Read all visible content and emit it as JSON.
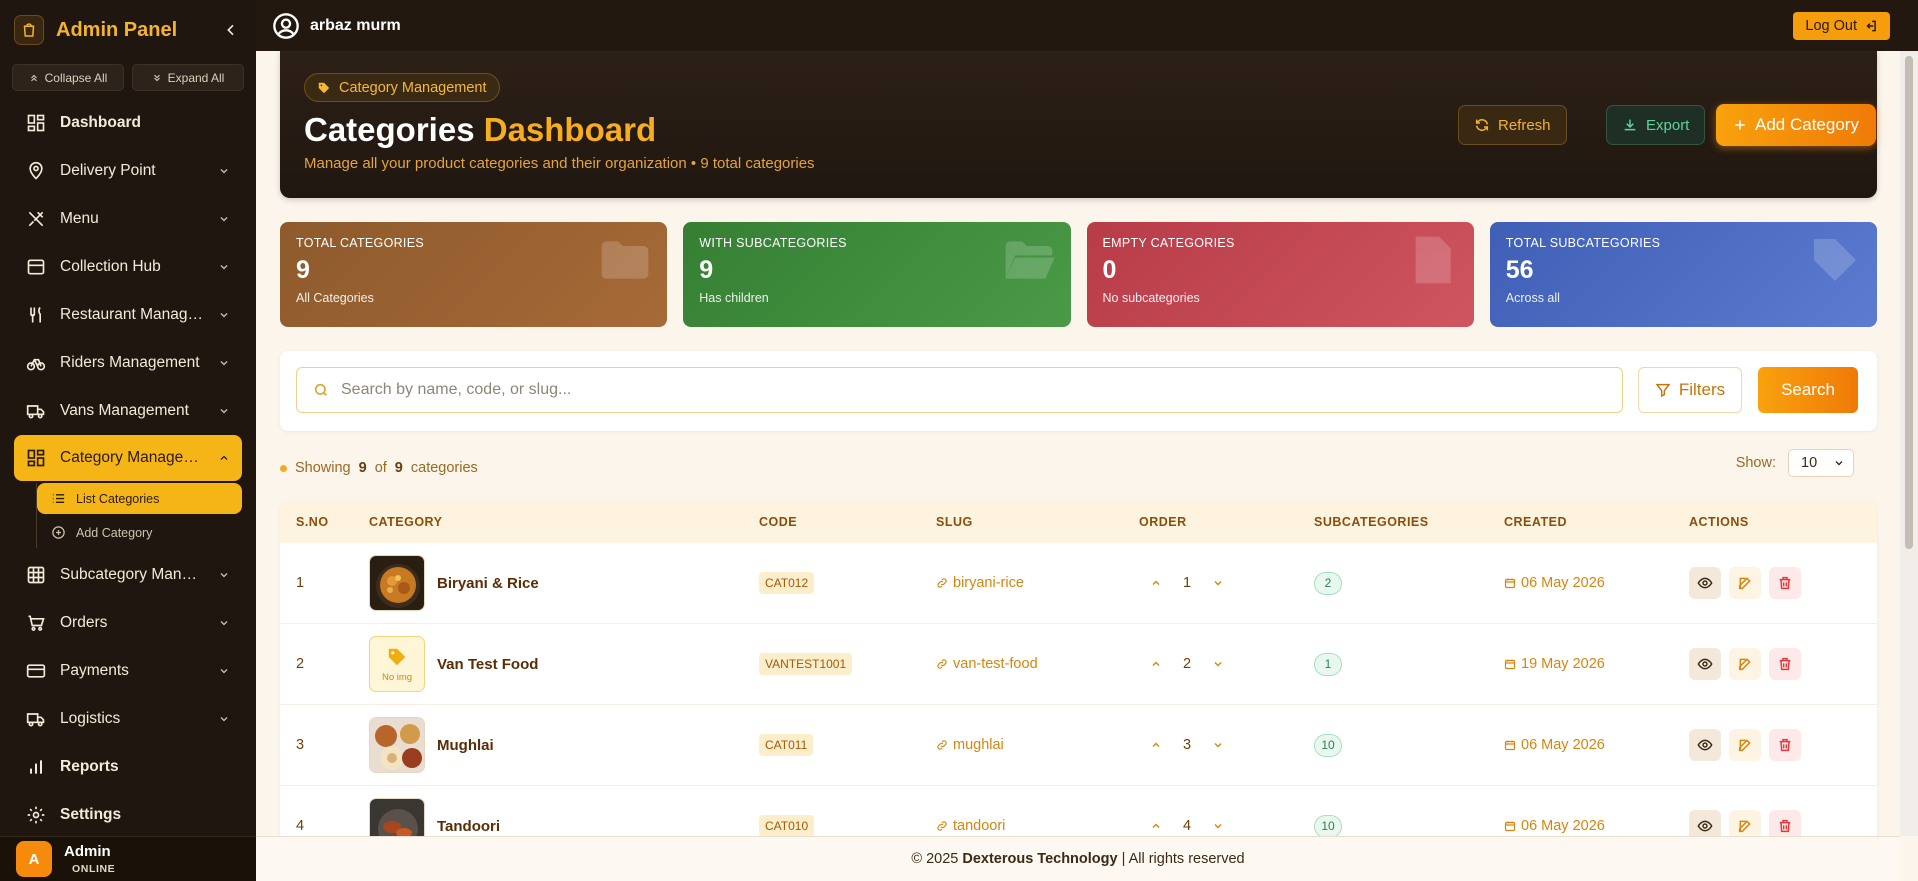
{
  "sidebar": {
    "title": "Admin Panel",
    "collapse_all": "Collapse All",
    "expand_all": "Expand All",
    "items": [
      {
        "label": "Dashboard",
        "icon": "grid-icon"
      },
      {
        "label": "Delivery Point",
        "icon": "map-pin-icon"
      },
      {
        "label": "Menu",
        "icon": "utensils-crossed-icon"
      },
      {
        "label": "Collection Hub",
        "icon": "box-icon"
      },
      {
        "label": "Restaurant Managem…",
        "icon": "fork-knife-icon"
      },
      {
        "label": "Riders Management",
        "icon": "bike-icon"
      },
      {
        "label": "Vans Management",
        "icon": "truck-icon"
      },
      {
        "label": "Category Management",
        "icon": "grid-icon"
      },
      {
        "label": "Subcategory Manage…",
        "icon": "table-icon"
      },
      {
        "label": "Orders",
        "icon": "cart-icon"
      },
      {
        "label": "Payments",
        "icon": "credit-card-icon"
      },
      {
        "label": "Logistics",
        "icon": "truck-icon"
      },
      {
        "label": "Reports",
        "icon": "bar-chart-icon"
      },
      {
        "label": "Settings",
        "icon": "gear-icon"
      }
    ],
    "sub_items": [
      {
        "label": "List Categories",
        "icon": "list-icon"
      },
      {
        "label": "Add Category",
        "icon": "plus-circle-icon"
      }
    ],
    "user": {
      "initial": "A",
      "name": "Admin",
      "status": "ONLINE"
    }
  },
  "topbar": {
    "user_name": "arbaz murm",
    "logout_label": "Log Out"
  },
  "hero": {
    "chip": "Category Management",
    "title_main": "Categories",
    "title_accent": "Dashboard",
    "subtitle": "Manage all your product categories and their organization • 9 total categories",
    "refresh_label": "Refresh",
    "export_label": "Export",
    "add_label": "Add Category"
  },
  "stats": [
    {
      "label": "TOTAL CATEGORIES",
      "value": "9",
      "sub": "All Categories",
      "color": "#8e5a2c"
    },
    {
      "label": "WITH SUBCATEGORIES",
      "value": "9",
      "sub": "Has children",
      "color": "#3e8a3c"
    },
    {
      "label": "EMPTY CATEGORIES",
      "value": "0",
      "sub": "No subcategories",
      "color": "#c04450"
    },
    {
      "label": "TOTAL SUBCATEGORIES",
      "value": "56",
      "sub": "Across all",
      "color": "#4c6bc0"
    }
  ],
  "search": {
    "placeholder": "Search by name, code, or slug...",
    "value": "",
    "filters_label": "Filters",
    "search_label": "Search"
  },
  "listing": {
    "showing_prefix": "Showing",
    "shown": "9",
    "of_text": "of",
    "total": "9",
    "suffix": "categories",
    "show_label": "Show:",
    "page_size": "10"
  },
  "table": {
    "headers": [
      "S.NO",
      "CATEGORY",
      "CODE",
      "SLUG",
      "ORDER",
      "SUBCATEGORIES",
      "CREATED",
      "ACTIONS"
    ],
    "rows": [
      {
        "sno": "1",
        "name": "Biryani & Rice",
        "image": "biryani",
        "code": "CAT012",
        "slug": "biryani-rice",
        "order": "1",
        "subcategories": "2",
        "created": "06 May 2026"
      },
      {
        "sno": "2",
        "name": "Van Test Food",
        "image": "none",
        "no_img_label": "No img",
        "code": "VANTEST1001",
        "slug": "van-test-food",
        "order": "2",
        "subcategories": "1",
        "created": "19 May 2026"
      },
      {
        "sno": "3",
        "name": "Mughlai",
        "image": "mughlai",
        "code": "CAT011",
        "slug": "mughlai",
        "order": "3",
        "subcategories": "10",
        "created": "06 May 2026"
      },
      {
        "sno": "4",
        "name": "Tandoori",
        "image": "tandoori",
        "code": "CAT010",
        "slug": "tandoori",
        "order": "4",
        "subcategories": "10",
        "created": "06 May 2026"
      }
    ]
  },
  "footer": {
    "prefix": "© 2025",
    "company": "Dexterous Technology",
    "suffix": "| All rights reserved"
  },
  "colors": {
    "accent": "#f6b516",
    "brand_orange": "#f07a07",
    "sidebar_bg": "#1f1610"
  }
}
